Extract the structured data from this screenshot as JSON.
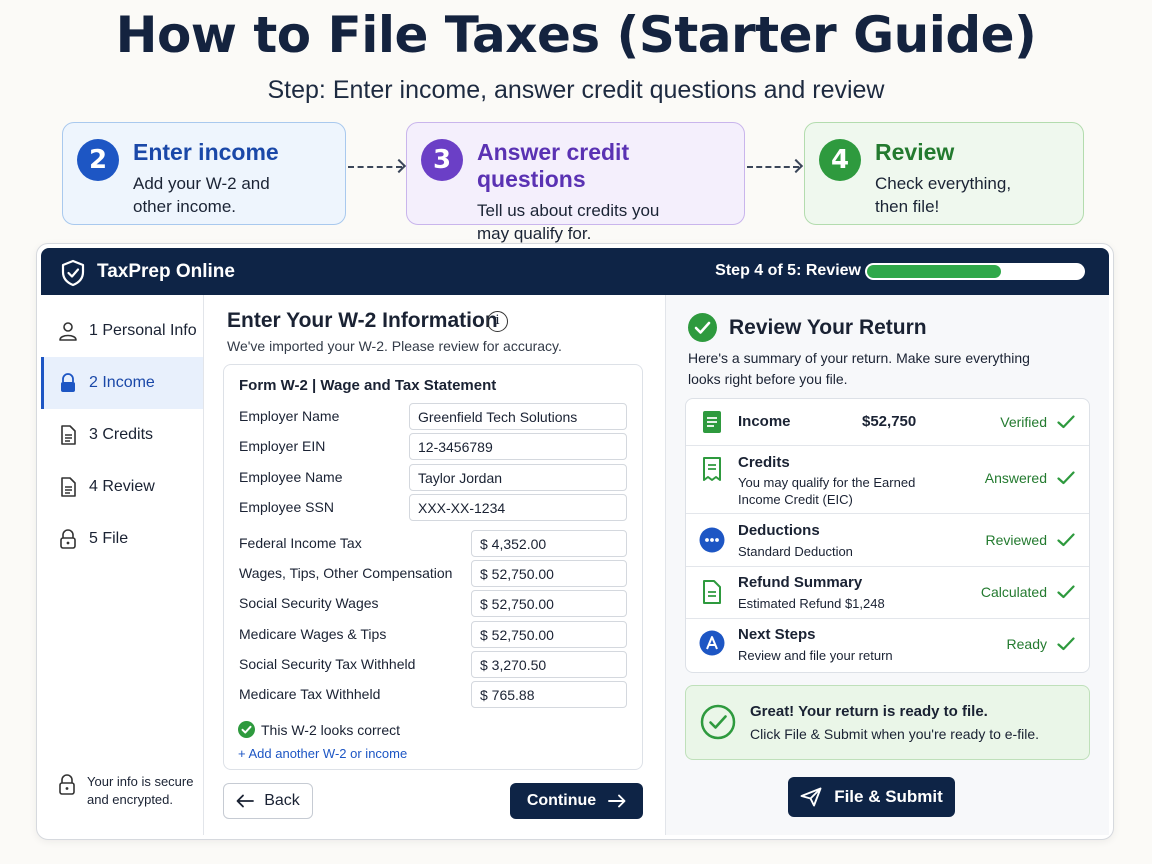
{
  "hero": {
    "title": "How to File Taxes (Starter Guide)",
    "subtitle": "Step: Enter income, answer credit questions and review"
  },
  "steps": [
    {
      "number": "2",
      "title": "Enter income",
      "desc_line1": "Add your W-2 and",
      "desc_line2": "other income.",
      "color": "#1d56c4"
    },
    {
      "number": "3",
      "title": "Answer credit questions",
      "desc_line1": "Tell us about credits you",
      "desc_line2": "may qualify for.",
      "color": "#6b3fc6"
    },
    {
      "number": "4",
      "title": "Review",
      "desc_line1": "Check everything,",
      "desc_line2": "then file!",
      "color": "#2e9a3e"
    }
  ],
  "app": {
    "name": "TaxPrep Online",
    "step_indicator": "Step 4 of 5: Review",
    "progress_fraction": 0.62
  },
  "sidebar": {
    "items": [
      {
        "label": "1 Personal Info",
        "icon": "person-icon"
      },
      {
        "label": "2 Income",
        "icon": "lock-icon"
      },
      {
        "label": "3 Credits",
        "icon": "document-icon"
      },
      {
        "label": "4 Review",
        "icon": "document-icon"
      },
      {
        "label": "5 File",
        "icon": "lock-icon"
      }
    ],
    "secure_line1": "Your info is secure",
    "secure_line2": "and encrypted."
  },
  "w2": {
    "title": "Enter Your W-2 Information",
    "subtitle": "We've imported your W-2. Please review for accuracy.",
    "form_title": "Form W-2 | Wage and Tax Statement",
    "fields": [
      {
        "label": "Employer Name",
        "value": "Greenfield Tech Solutions"
      },
      {
        "label": "Employer EIN",
        "value": "12-3456789"
      },
      {
        "label": "Employee Name",
        "value": "Taylor Jordan"
      },
      {
        "label": "Employee SSN",
        "value": "XXX-XX-1234"
      }
    ],
    "amounts": [
      {
        "label": "Federal Income Tax",
        "value": "$  4,352.00"
      },
      {
        "label": "Wages, Tips, Other Compensation",
        "value": "$  52,750.00"
      },
      {
        "label": "Social Security Wages",
        "value": "$  52,750.00"
      },
      {
        "label": "Medicare Wages & Tips",
        "value": "$  52,750.00"
      },
      {
        "label": "Social Security Tax Withheld",
        "value": "$  3,270.50"
      },
      {
        "label": "Medicare Tax Withheld",
        "value": "$  765.88"
      }
    ],
    "confirm_text": "This W-2 looks correct",
    "add_link": "+ Add another W-2 or income",
    "back_label": "Back",
    "continue_label": "Continue"
  },
  "review": {
    "title": "Review Your Return",
    "subtitle": "Here's a summary of your return. Make sure everything looks right before you file.",
    "rows": [
      {
        "name": "Income",
        "amount": "$52,750",
        "desc1": "",
        "desc2": "",
        "status": "Verified"
      },
      {
        "name": "Credits",
        "amount": "",
        "desc1": "You may qualify for the Earned",
        "desc2": "Income Credit (EIC)",
        "status": "Answered"
      },
      {
        "name": "Deductions",
        "amount": "",
        "desc1": "Standard Deduction",
        "desc2": "",
        "status": "Reviewed"
      },
      {
        "name": "Refund Summary",
        "amount": "",
        "desc1": "Estimated Refund $1,248",
        "desc2": "",
        "status": "Calculated"
      },
      {
        "name": "Next Steps",
        "amount": "",
        "desc1": "Review and file your return",
        "desc2": "",
        "status": "Ready"
      }
    ],
    "ready_title": "Great! Your return is ready to file.",
    "ready_desc": "Click File & Submit when you're ready to e-file.",
    "file_label": "File & Submit"
  },
  "colors": {
    "navy": "#0e2446",
    "green": "#2fa84a",
    "blue": "#1d56c4",
    "purple": "#6b3fc6"
  }
}
